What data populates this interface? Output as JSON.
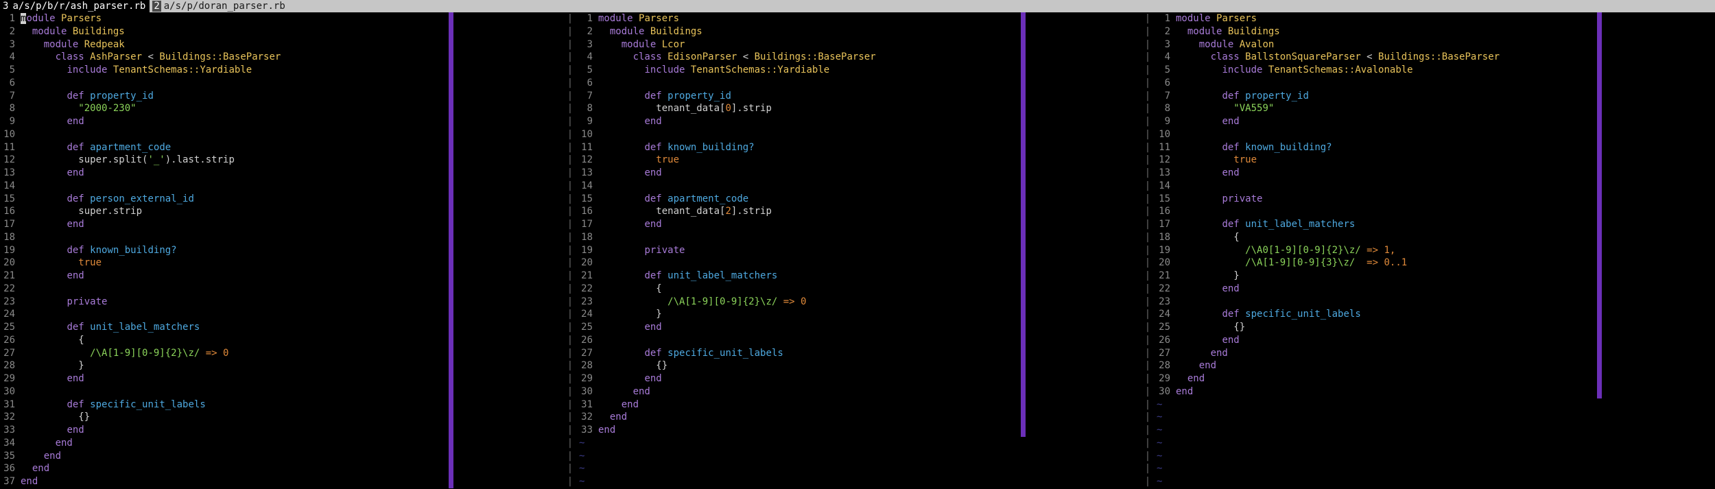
{
  "tabs": [
    {
      "num": "3",
      "label": "a/s/p/b/r/ash_parser.rb",
      "active": true
    },
    {
      "num": "2",
      "label": "a/s/p/doran_parser.rb",
      "active": false
    }
  ],
  "colors": {
    "background": "#000000",
    "keyword": "#a87bd8",
    "constant": "#e8c35a",
    "method": "#4ea9e0",
    "string": "#8bd35a",
    "number": "#e08a3a",
    "line_number": "#8a8a8a",
    "color_column": "#6b2fb8",
    "tilde": "#3c3c8a"
  },
  "panes": [
    {
      "name": "ash-parser",
      "tildes": 0,
      "lines": [
        [
          [
            "kw",
            "module"
          ],
          [
            "plain",
            " "
          ],
          [
            "const",
            "Parsers"
          ]
        ],
        [
          [
            "plain",
            "  "
          ],
          [
            "kw",
            "module"
          ],
          [
            "plain",
            " "
          ],
          [
            "const",
            "Buildings"
          ]
        ],
        [
          [
            "plain",
            "    "
          ],
          [
            "kw",
            "module"
          ],
          [
            "plain",
            " "
          ],
          [
            "const",
            "Redpeak"
          ]
        ],
        [
          [
            "plain",
            "      "
          ],
          [
            "kw",
            "class"
          ],
          [
            "plain",
            " "
          ],
          [
            "const",
            "AshParser"
          ],
          [
            "plain",
            " < "
          ],
          [
            "const",
            "Buildings::BaseParser"
          ]
        ],
        [
          [
            "plain",
            "        "
          ],
          [
            "kw",
            "include"
          ],
          [
            "plain",
            " "
          ],
          [
            "const",
            "TenantSchemas::Yardiable"
          ]
        ],
        [],
        [
          [
            "plain",
            "        "
          ],
          [
            "kw",
            "def"
          ],
          [
            "plain",
            " "
          ],
          [
            "meth",
            "property_id"
          ]
        ],
        [
          [
            "plain",
            "          "
          ],
          [
            "str",
            "\"2000-230\""
          ]
        ],
        [
          [
            "plain",
            "        "
          ],
          [
            "kw",
            "end"
          ]
        ],
        [],
        [
          [
            "plain",
            "        "
          ],
          [
            "kw",
            "def"
          ],
          [
            "plain",
            " "
          ],
          [
            "meth",
            "apartment_code"
          ]
        ],
        [
          [
            "plain",
            "          super.split("
          ],
          [
            "str",
            "'_'"
          ],
          [
            "plain",
            ").last.strip"
          ]
        ],
        [
          [
            "plain",
            "        "
          ],
          [
            "kw",
            "end"
          ]
        ],
        [],
        [
          [
            "plain",
            "        "
          ],
          [
            "kw",
            "def"
          ],
          [
            "plain",
            " "
          ],
          [
            "meth",
            "person_external_id"
          ]
        ],
        [
          [
            "plain",
            "          super.strip"
          ]
        ],
        [
          [
            "plain",
            "        "
          ],
          [
            "kw",
            "end"
          ]
        ],
        [],
        [
          [
            "plain",
            "        "
          ],
          [
            "kw",
            "def"
          ],
          [
            "plain",
            " "
          ],
          [
            "meth",
            "known_building?"
          ]
        ],
        [
          [
            "plain",
            "          "
          ],
          [
            "sym",
            "true"
          ]
        ],
        [
          [
            "plain",
            "        "
          ],
          [
            "kw",
            "end"
          ]
        ],
        [],
        [
          [
            "plain",
            "        "
          ],
          [
            "kw",
            "private"
          ]
        ],
        [],
        [
          [
            "plain",
            "        "
          ],
          [
            "kw",
            "def"
          ],
          [
            "plain",
            " "
          ],
          [
            "meth",
            "unit_label_matchers"
          ]
        ],
        [
          [
            "plain",
            "          {"
          ]
        ],
        [
          [
            "plain",
            "            "
          ],
          [
            "rx",
            "/\\A[1-9][0-9]{2}\\z/"
          ],
          [
            "plain",
            " "
          ],
          [
            "sym",
            "=> 0"
          ]
        ],
        [
          [
            "plain",
            "          }"
          ]
        ],
        [
          [
            "plain",
            "        "
          ],
          [
            "kw",
            "end"
          ]
        ],
        [],
        [
          [
            "plain",
            "        "
          ],
          [
            "kw",
            "def"
          ],
          [
            "plain",
            " "
          ],
          [
            "meth",
            "specific_unit_labels"
          ]
        ],
        [
          [
            "plain",
            "          {}"
          ]
        ],
        [
          [
            "plain",
            "        "
          ],
          [
            "kw",
            "end"
          ]
        ],
        [
          [
            "plain",
            "      "
          ],
          [
            "kw",
            "end"
          ]
        ],
        [
          [
            "plain",
            "    "
          ],
          [
            "kw",
            "end"
          ]
        ],
        [
          [
            "plain",
            "  "
          ],
          [
            "kw",
            "end"
          ]
        ],
        [
          [
            "kw",
            "end"
          ]
        ]
      ]
    },
    {
      "name": "edison-parser",
      "tildes": 4,
      "lines": [
        [
          [
            "kw",
            "module"
          ],
          [
            "plain",
            " "
          ],
          [
            "const",
            "Parsers"
          ]
        ],
        [
          [
            "plain",
            "  "
          ],
          [
            "kw",
            "module"
          ],
          [
            "plain",
            " "
          ],
          [
            "const",
            "Buildings"
          ]
        ],
        [
          [
            "plain",
            "    "
          ],
          [
            "kw",
            "module"
          ],
          [
            "plain",
            " "
          ],
          [
            "const",
            "Lcor"
          ]
        ],
        [
          [
            "plain",
            "      "
          ],
          [
            "kw",
            "class"
          ],
          [
            "plain",
            " "
          ],
          [
            "const",
            "EdisonParser"
          ],
          [
            "plain",
            " < "
          ],
          [
            "const",
            "Buildings::BaseParser"
          ]
        ],
        [
          [
            "plain",
            "        "
          ],
          [
            "kw",
            "include"
          ],
          [
            "plain",
            " "
          ],
          [
            "const",
            "TenantSchemas::Yardiable"
          ]
        ],
        [],
        [
          [
            "plain",
            "        "
          ],
          [
            "kw",
            "def"
          ],
          [
            "plain",
            " "
          ],
          [
            "meth",
            "property_id"
          ]
        ],
        [
          [
            "plain",
            "          tenant_data["
          ],
          [
            "sym",
            "0"
          ],
          [
            "plain",
            "].strip"
          ]
        ],
        [
          [
            "plain",
            "        "
          ],
          [
            "kw",
            "end"
          ]
        ],
        [],
        [
          [
            "plain",
            "        "
          ],
          [
            "kw",
            "def"
          ],
          [
            "plain",
            " "
          ],
          [
            "meth",
            "known_building?"
          ]
        ],
        [
          [
            "plain",
            "          "
          ],
          [
            "sym",
            "true"
          ]
        ],
        [
          [
            "plain",
            "        "
          ],
          [
            "kw",
            "end"
          ]
        ],
        [],
        [
          [
            "plain",
            "        "
          ],
          [
            "kw",
            "def"
          ],
          [
            "plain",
            " "
          ],
          [
            "meth",
            "apartment_code"
          ]
        ],
        [
          [
            "plain",
            "          tenant_data["
          ],
          [
            "sym",
            "2"
          ],
          [
            "plain",
            "].strip"
          ]
        ],
        [
          [
            "plain",
            "        "
          ],
          [
            "kw",
            "end"
          ]
        ],
        [],
        [
          [
            "plain",
            "        "
          ],
          [
            "kw",
            "private"
          ]
        ],
        [],
        [
          [
            "plain",
            "        "
          ],
          [
            "kw",
            "def"
          ],
          [
            "plain",
            " "
          ],
          [
            "meth",
            "unit_label_matchers"
          ]
        ],
        [
          [
            "plain",
            "          {"
          ]
        ],
        [
          [
            "plain",
            "            "
          ],
          [
            "rx",
            "/\\A[1-9][0-9]{2}\\z/"
          ],
          [
            "plain",
            " "
          ],
          [
            "sym",
            "=> 0"
          ]
        ],
        [
          [
            "plain",
            "          }"
          ]
        ],
        [
          [
            "plain",
            "        "
          ],
          [
            "kw",
            "end"
          ]
        ],
        [],
        [
          [
            "plain",
            "        "
          ],
          [
            "kw",
            "def"
          ],
          [
            "plain",
            " "
          ],
          [
            "meth",
            "specific_unit_labels"
          ]
        ],
        [
          [
            "plain",
            "          {}"
          ]
        ],
        [
          [
            "plain",
            "        "
          ],
          [
            "kw",
            "end"
          ]
        ],
        [
          [
            "plain",
            "      "
          ],
          [
            "kw",
            "end"
          ]
        ],
        [
          [
            "plain",
            "    "
          ],
          [
            "kw",
            "end"
          ]
        ],
        [
          [
            "plain",
            "  "
          ],
          [
            "kw",
            "end"
          ]
        ],
        [
          [
            "kw",
            "end"
          ]
        ]
      ]
    },
    {
      "name": "ballston-square-parser",
      "tildes": 7,
      "lines": [
        [
          [
            "kw",
            "module"
          ],
          [
            "plain",
            " "
          ],
          [
            "const",
            "Parsers"
          ]
        ],
        [
          [
            "plain",
            "  "
          ],
          [
            "kw",
            "module"
          ],
          [
            "plain",
            " "
          ],
          [
            "const",
            "Buildings"
          ]
        ],
        [
          [
            "plain",
            "    "
          ],
          [
            "kw",
            "module"
          ],
          [
            "plain",
            " "
          ],
          [
            "const",
            "Avalon"
          ]
        ],
        [
          [
            "plain",
            "      "
          ],
          [
            "kw",
            "class"
          ],
          [
            "plain",
            " "
          ],
          [
            "const",
            "BallstonSquareParser"
          ],
          [
            "plain",
            " < "
          ],
          [
            "const",
            "Buildings::BaseParser"
          ]
        ],
        [
          [
            "plain",
            "        "
          ],
          [
            "kw",
            "include"
          ],
          [
            "plain",
            " "
          ],
          [
            "const",
            "TenantSchemas::Avalonable"
          ]
        ],
        [],
        [
          [
            "plain",
            "        "
          ],
          [
            "kw",
            "def"
          ],
          [
            "plain",
            " "
          ],
          [
            "meth",
            "property_id"
          ]
        ],
        [
          [
            "plain",
            "          "
          ],
          [
            "str",
            "\"VA559\""
          ]
        ],
        [
          [
            "plain",
            "        "
          ],
          [
            "kw",
            "end"
          ]
        ],
        [],
        [
          [
            "plain",
            "        "
          ],
          [
            "kw",
            "def"
          ],
          [
            "plain",
            " "
          ],
          [
            "meth",
            "known_building?"
          ]
        ],
        [
          [
            "plain",
            "          "
          ],
          [
            "sym",
            "true"
          ]
        ],
        [
          [
            "plain",
            "        "
          ],
          [
            "kw",
            "end"
          ]
        ],
        [],
        [
          [
            "plain",
            "        "
          ],
          [
            "kw",
            "private"
          ]
        ],
        [],
        [
          [
            "plain",
            "        "
          ],
          [
            "kw",
            "def"
          ],
          [
            "plain",
            " "
          ],
          [
            "meth",
            "unit_label_matchers"
          ]
        ],
        [
          [
            "plain",
            "          {"
          ]
        ],
        [
          [
            "plain",
            "            "
          ],
          [
            "rx",
            "/\\A0[1-9][0-9]{2}\\z/"
          ],
          [
            "plain",
            " "
          ],
          [
            "sym",
            "=> 1,"
          ]
        ],
        [
          [
            "plain",
            "            "
          ],
          [
            "rx",
            "/\\A[1-9][0-9]{3}\\z/"
          ],
          [
            "plain",
            "  "
          ],
          [
            "sym",
            "=> 0..1"
          ]
        ],
        [
          [
            "plain",
            "          }"
          ]
        ],
        [
          [
            "plain",
            "        "
          ],
          [
            "kw",
            "end"
          ]
        ],
        [],
        [
          [
            "plain",
            "        "
          ],
          [
            "kw",
            "def"
          ],
          [
            "plain",
            " "
          ],
          [
            "meth",
            "specific_unit_labels"
          ]
        ],
        [
          [
            "plain",
            "          {}"
          ]
        ],
        [
          [
            "plain",
            "        "
          ],
          [
            "kw",
            "end"
          ]
        ],
        [
          [
            "plain",
            "      "
          ],
          [
            "kw",
            "end"
          ]
        ],
        [
          [
            "plain",
            "    "
          ],
          [
            "kw",
            "end"
          ]
        ],
        [
          [
            "plain",
            "  "
          ],
          [
            "kw",
            "end"
          ]
        ],
        [
          [
            "kw",
            "end"
          ]
        ]
      ]
    }
  ],
  "separator": "|",
  "tilde": "~"
}
